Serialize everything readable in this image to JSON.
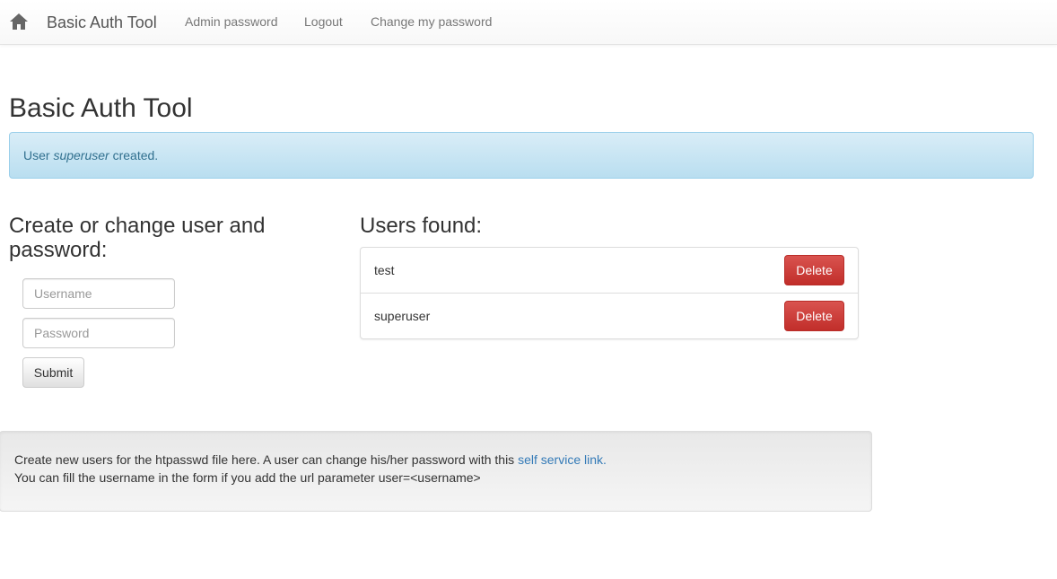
{
  "navbar": {
    "home_icon": "home-icon",
    "brand": "Basic Auth Tool",
    "links": {
      "admin_password": "Admin password",
      "logout": "Logout",
      "change_my_password": "Change my password"
    }
  },
  "page_title": "Basic Auth Tool",
  "alert": {
    "prefix": "User ",
    "username": "superuser",
    "suffix": " created."
  },
  "create_form": {
    "title": "Create or change user and password:",
    "username_placeholder": "Username",
    "username_value": "",
    "password_placeholder": "Password",
    "password_value": "",
    "submit_label": "Submit"
  },
  "users": {
    "title": "Users found:",
    "list": [
      {
        "name": "test",
        "delete_label": "Delete"
      },
      {
        "name": "superuser",
        "delete_label": "Delete"
      }
    ]
  },
  "footer": {
    "line1_text": "Create new users for the htpasswd file here. A user can change his/her password with this ",
    "line1_link": "self service link.",
    "line2_text": "You can fill the username in the form if you add the url parameter user=<username>"
  },
  "colors": {
    "danger": "#d9534f",
    "info_bg": "#d9edf7",
    "link": "#337ab7"
  }
}
